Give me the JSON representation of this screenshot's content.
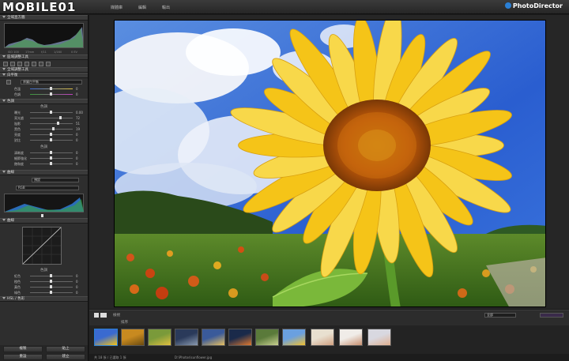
{
  "topbar": {
    "logo_text": "MOBILE01",
    "tabs": [
      "媒體庫",
      "編輯",
      "輸出"
    ],
    "brand": "PhotoDirector"
  },
  "left_panel": {
    "histogram_title": "全域直方圖",
    "histogram_stats": [
      "ISO 100",
      "17mm",
      "f/11",
      "1/160",
      "0 EV"
    ],
    "tools_title": "區域調整工具",
    "global_title": "全域調整工具",
    "sections": [
      {
        "title": "白平衡"
      },
      {
        "title": "色調"
      },
      {
        "title": "曲線"
      },
      {
        "title": "HSL / 色彩"
      }
    ],
    "wb_preset": "原圖白平衡",
    "wb_sliders": [
      {
        "label": "色溫",
        "value": "0"
      },
      {
        "label": "色調",
        "value": "0"
      }
    ],
    "tone_subtitle": "色調",
    "tone_sliders": [
      {
        "label": "曝光",
        "value": "0.00"
      },
      {
        "label": "亮光處",
        "value": "72"
      },
      {
        "label": "陰影",
        "value": "51"
      },
      {
        "label": "黑色",
        "value": "19"
      },
      {
        "label": "亮度",
        "value": "0"
      },
      {
        "label": "對比",
        "value": "0"
      }
    ],
    "presence_subtitle": "色調",
    "presence_sliders": [
      {
        "label": "清晰度",
        "value": "0"
      },
      {
        "label": "細節強化",
        "value": "0"
      },
      {
        "label": "飽和度",
        "value": "0"
      }
    ],
    "curve_preset": "預設",
    "curve_channel": "RGB",
    "curve_label": "曲線",
    "hsl_subtitle": "色調",
    "hsl_sliders": [
      {
        "label": "紅色",
        "value": "0"
      },
      {
        "label": "橙色",
        "value": "0"
      },
      {
        "label": "黃色",
        "value": "0"
      },
      {
        "label": "綠色",
        "value": "0"
      }
    ],
    "buttons": {
      "copy": "複製",
      "paste": "貼上",
      "reset": "重設",
      "create": "建立"
    }
  },
  "filmbar": {
    "sort_label": "排序",
    "view_label": "檢視",
    "filter_label": "全部"
  },
  "status": {
    "left": "共 18 張 / 已選取 1 張",
    "path": "D:\\Photos\\sunflower.jpg"
  },
  "colors": {
    "accent": "#2a7fd4",
    "panel": "#2e2e2e",
    "sunflower_petal": "#f5c418",
    "sky": "#2f63c9"
  }
}
